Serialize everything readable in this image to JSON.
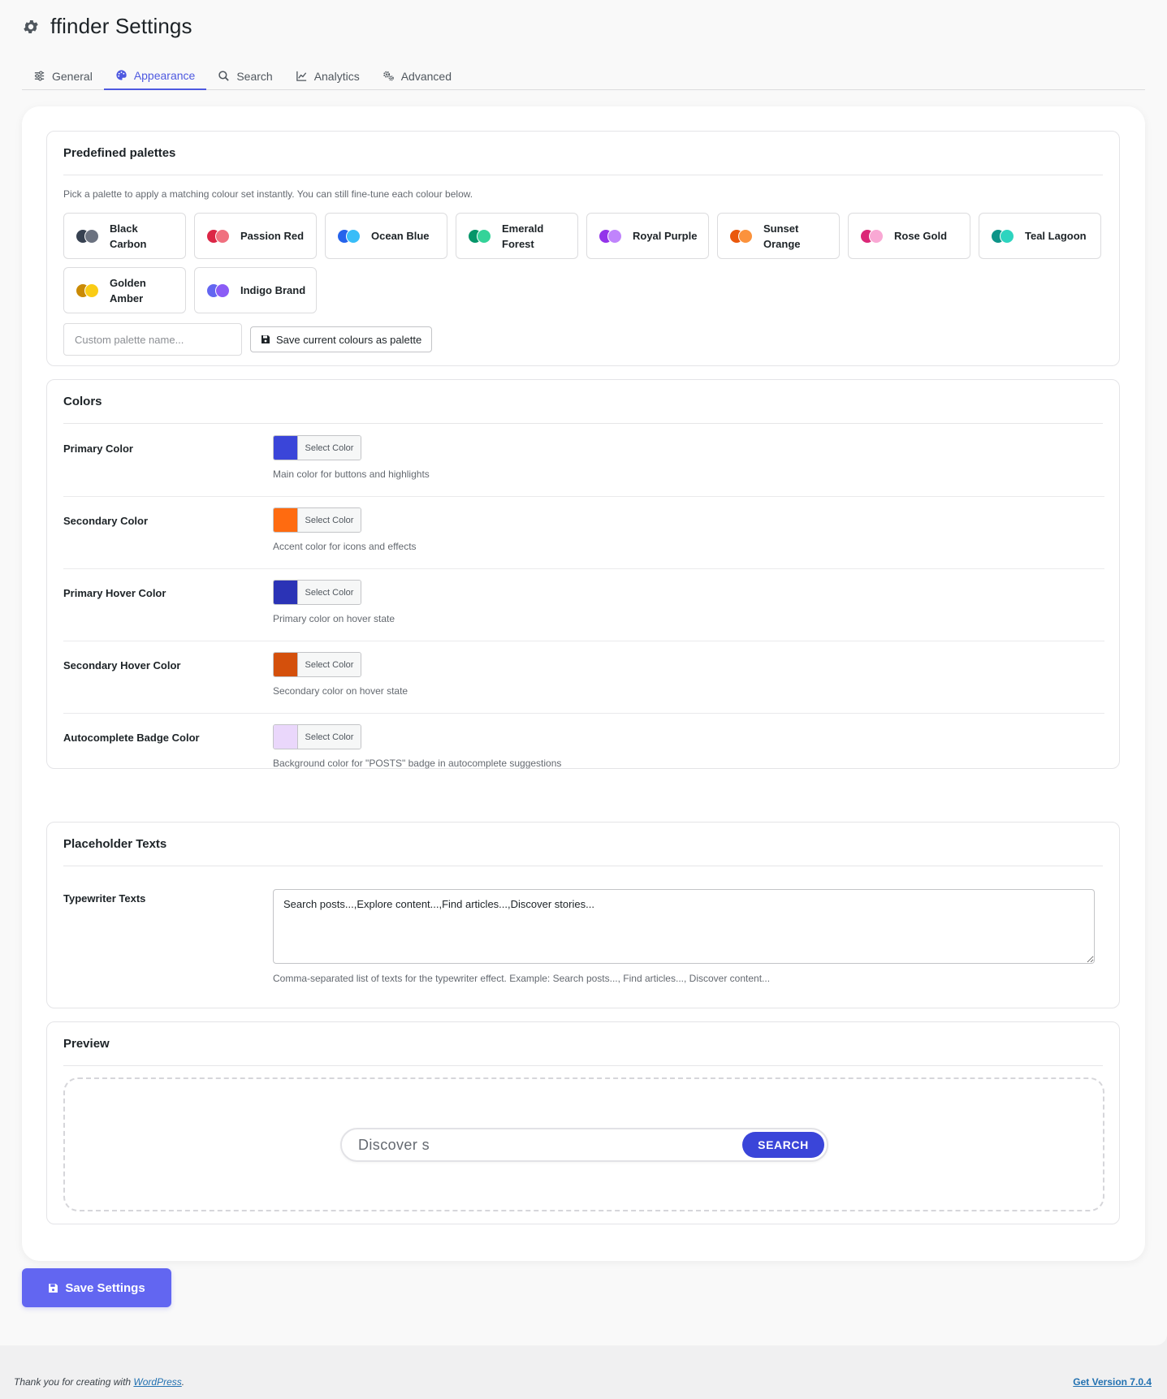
{
  "page": {
    "title": "ffinder Settings"
  },
  "tabs": [
    {
      "label": "General",
      "icon": "sliders-icon"
    },
    {
      "label": "Appearance",
      "icon": "palette-icon",
      "active": true
    },
    {
      "label": "Search",
      "icon": "search-icon"
    },
    {
      "label": "Analytics",
      "icon": "chart-icon"
    },
    {
      "label": "Advanced",
      "icon": "cogs-icon"
    }
  ],
  "palettes_section": {
    "heading": "Predefined palettes",
    "hint": "Pick a palette to apply a matching colour set instantly. You can still fine-tune each colour below.",
    "items": [
      {
        "name": "Black Carbon",
        "c1": "#374151",
        "c2": "#6b7280"
      },
      {
        "name": "Passion Red",
        "c1": "#dc2646",
        "c2": "#f0707f"
      },
      {
        "name": "Ocean Blue",
        "c1": "#2563eb",
        "c2": "#38bdf8"
      },
      {
        "name": "Emerald Forest",
        "c1": "#059669",
        "c2": "#34d399"
      },
      {
        "name": "Royal Purple",
        "c1": "#9333ea",
        "c2": "#c084fc"
      },
      {
        "name": "Sunset Orange",
        "c1": "#ea580c",
        "c2": "#fb923c"
      },
      {
        "name": "Rose Gold",
        "c1": "#db2777",
        "c2": "#f9a8d4"
      },
      {
        "name": "Teal Lagoon",
        "c1": "#0d9488",
        "c2": "#2dd4bf"
      },
      {
        "name": "Golden Amber",
        "c1": "#ca8a04",
        "c2": "#facc15"
      },
      {
        "name": "Indigo Brand",
        "c1": "#6366f1",
        "c2": "#8b5cf6"
      }
    ],
    "custom_placeholder": "Custom palette name...",
    "custom_value": "",
    "save_palette_label": "Save current colours as palette"
  },
  "colors_section": {
    "heading": "Colors",
    "picker_label": "Select Color",
    "rows": [
      {
        "label": "Primary Color",
        "color": "#3a45d9",
        "desc": "Main color for buttons and highlights"
      },
      {
        "label": "Secondary Color",
        "color": "#ff6b10",
        "desc": "Accent color for icons and effects"
      },
      {
        "label": "Primary Hover Color",
        "color": "#2b33b6",
        "desc": "Primary color on hover state"
      },
      {
        "label": "Secondary Hover Color",
        "color": "#d4500c",
        "desc": "Secondary color on hover state"
      },
      {
        "label": "Autocomplete Badge Color",
        "color": "#ead7fb",
        "desc": "Background color for \"POSTS\" badge in autocomplete suggestions"
      }
    ]
  },
  "placeholder_section": {
    "heading": "Placeholder Texts",
    "field_label": "Typewriter Texts",
    "value": "Search posts...,Explore content...,Find articles...,Discover stories...",
    "desc": "Comma-separated list of texts for the typewriter effect. Example: Search posts..., Find articles..., Discover content..."
  },
  "preview_section": {
    "heading": "Preview",
    "search_text": "Discover s",
    "search_button": "SEARCH"
  },
  "save_button": "Save Settings",
  "footer": {
    "thanks_prefix": "Thank you for creating with ",
    "thanks_link": "WordPress",
    "thanks_suffix": ".",
    "version_link": "Get Version 7.0.4"
  },
  "colors": {
    "accent": "#4e59e0",
    "save_button_bg": "#6266f1",
    "search_button_bg": "#3a45d9"
  }
}
